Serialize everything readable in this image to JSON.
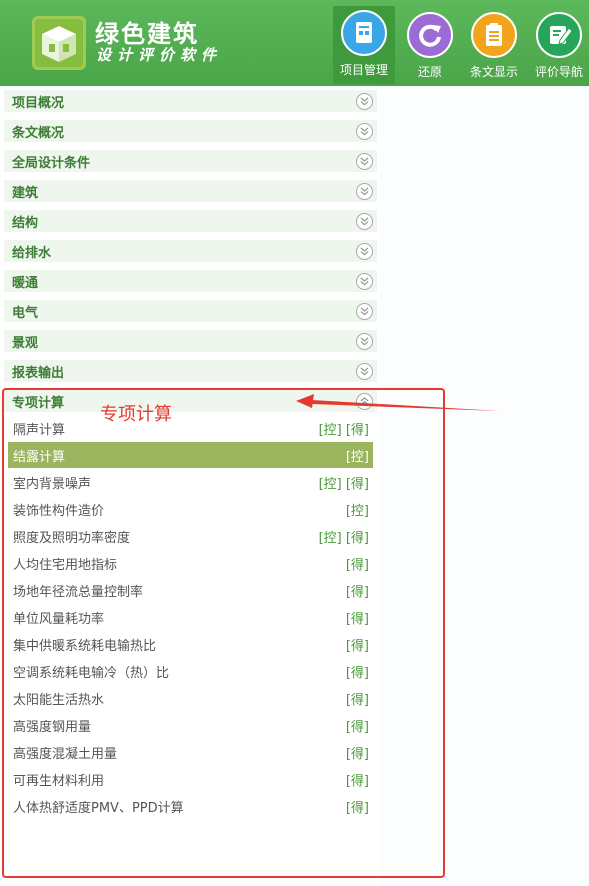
{
  "header": {
    "title": "绿色建筑",
    "subtitle": "设计评价软件",
    "buttons": [
      {
        "label": "项目管理",
        "icon": "document-icon",
        "color": "#3aa6e8"
      },
      {
        "label": "还原",
        "icon": "refresh-icon",
        "color": "#9b6cd6"
      },
      {
        "label": "条文显示",
        "icon": "clipboard-icon",
        "color": "#f2a51c"
      },
      {
        "label": "评价导航",
        "icon": "edit-icon",
        "color": "#26a65a"
      }
    ]
  },
  "categories": [
    {
      "label": "项目概况"
    },
    {
      "label": "条文概况"
    },
    {
      "label": "全局设计条件"
    },
    {
      "label": "建筑"
    },
    {
      "label": "结构"
    },
    {
      "label": "给排水"
    },
    {
      "label": "暖通"
    },
    {
      "label": "电气"
    },
    {
      "label": "景观"
    },
    {
      "label": "报表输出"
    },
    {
      "label": "专项计算"
    }
  ],
  "items": [
    {
      "label": "隔声计算",
      "tags": "[控] [得]"
    },
    {
      "label": "结露计算",
      "tags": "[控]"
    },
    {
      "label": "室内背景噪声",
      "tags": "[控] [得]"
    },
    {
      "label": "装饰性构件造价",
      "tags": "[控]"
    },
    {
      "label": "照度及照明功率密度",
      "tags": "[控] [得]"
    },
    {
      "label": "人均住宅用地指标",
      "tags": "[得]"
    },
    {
      "label": "场地年径流总量控制率",
      "tags": "[得]"
    },
    {
      "label": "单位风量耗功率",
      "tags": "[得]"
    },
    {
      "label": "集中供暖系统耗电输热比",
      "tags": "[得]"
    },
    {
      "label": "空调系统耗电输冷（热）比",
      "tags": "[得]"
    },
    {
      "label": "太阳能生活热水",
      "tags": "[得]"
    },
    {
      "label": "高强度钢用量",
      "tags": "[得]"
    },
    {
      "label": "高强度混凝土用量",
      "tags": "[得]"
    },
    {
      "label": "可再生材料利用",
      "tags": "[得]"
    },
    {
      "label": "人体热舒适度PMV、PPD计算",
      "tags": "[得]"
    }
  ],
  "annotation": {
    "text": "专项计算",
    "color": "#e53a2f"
  }
}
